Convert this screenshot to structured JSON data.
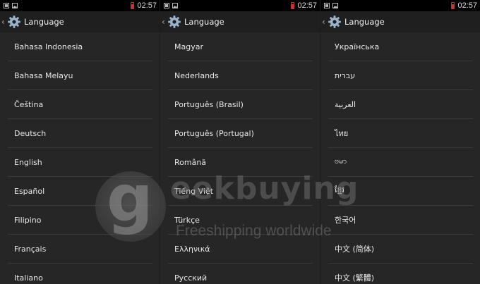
{
  "status_bar": {
    "time": "02:57"
  },
  "action_bar": {
    "title": "Language"
  },
  "panels": [
    {
      "items": [
        "Bahasa Indonesia",
        "Bahasa Melayu",
        "Čeština",
        "Deutsch",
        "English",
        "Español",
        "Filipino",
        "Français",
        "Italiano"
      ]
    },
    {
      "items": [
        "Magyar",
        "Nederlands",
        "Português (Brasil)",
        "Português (Portugal)",
        "Română",
        "Tiếng Việt",
        "Türkçe",
        "Ελληνικά",
        "Русский"
      ]
    },
    {
      "items": [
        "Українська",
        "עברית",
        "العربية",
        "ไทย",
        "ဗမာ",
        "ខ្មែរ",
        "한국어",
        "中文 (简体)",
        "中文 (繁體)"
      ]
    }
  ],
  "watermark": {
    "logo_letter": "g",
    "brand": "eekbuying",
    "tagline": "Freeshipping worldwide"
  },
  "colors": {
    "background": "#262626",
    "status_bar": "#000000",
    "battery": "#cc3333",
    "divider": "#3a3a3a"
  },
  "icons": {
    "gallery": "image-icon",
    "settings": "gear-icon",
    "back": "chevron-left-icon"
  }
}
